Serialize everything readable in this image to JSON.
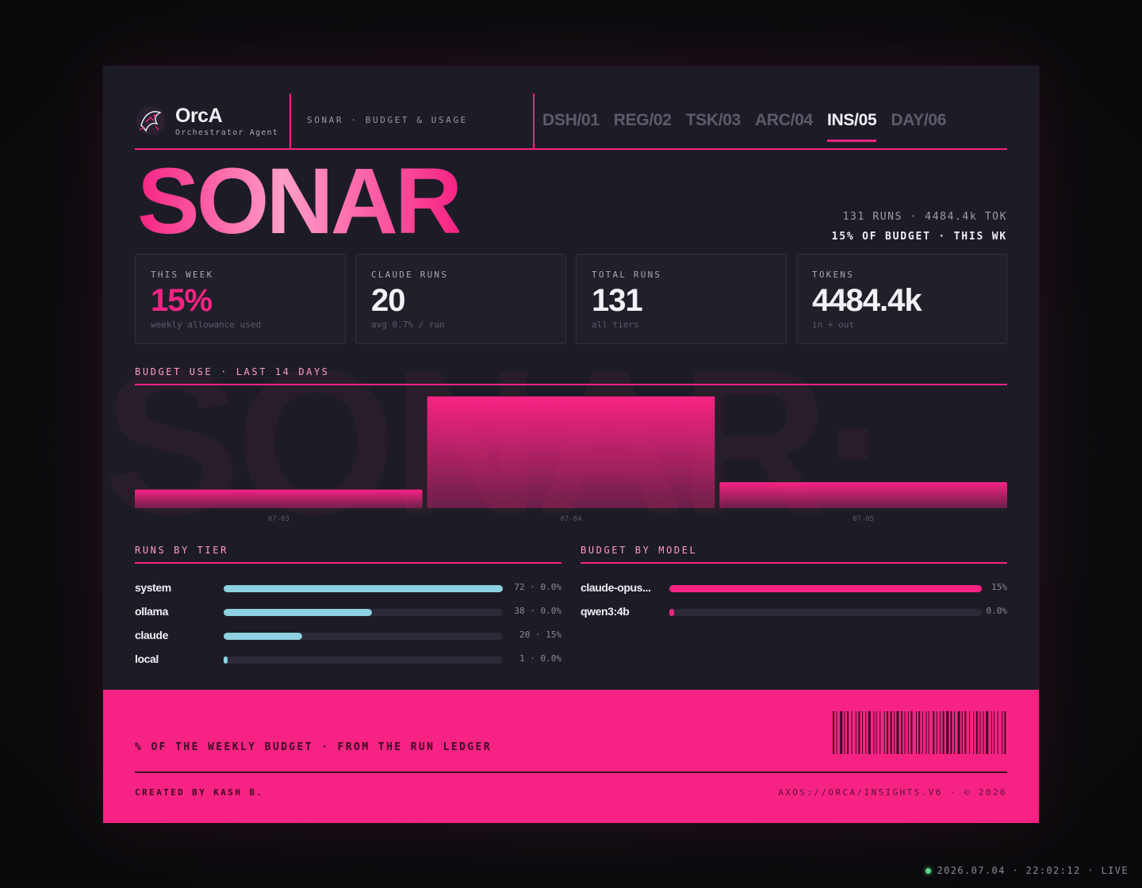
{
  "brand": {
    "name": "OrcA",
    "subtitle": "Orchestrator Agent"
  },
  "breadcrumb": "SONAR · BUDGET & USAGE",
  "nav": {
    "tabs": [
      {
        "label": "DSH/01",
        "active": false
      },
      {
        "label": "REG/02",
        "active": false
      },
      {
        "label": "TSK/03",
        "active": false
      },
      {
        "label": "ARC/04",
        "active": false
      },
      {
        "label": "INS/05",
        "active": true
      },
      {
        "label": "DAY/06",
        "active": false
      }
    ]
  },
  "hero": {
    "title": "SONAR",
    "meta_line1": "131 RUNS · 4484.4k TOK",
    "meta_line2": "15% OF BUDGET · THIS WK",
    "watermark": "SONAR·"
  },
  "stats": [
    {
      "label": "THIS WEEK",
      "value": "15%",
      "note": "weekly allowance used"
    },
    {
      "label": "CLAUDE RUNS",
      "value": "20",
      "note": "avg 0.7% / run"
    },
    {
      "label": "TOTAL RUNS",
      "value": "131",
      "note": "all tiers"
    },
    {
      "label": "TOKENS",
      "value": "4484.4k",
      "note": "in + out"
    }
  ],
  "budget_chart": {
    "title": "BUDGET USE · LAST 14 DAYS"
  },
  "chart_data": {
    "type": "bar",
    "title": "BUDGET USE · LAST 14 DAYS",
    "categories": [
      "07-03",
      "07-04",
      "07-05"
    ],
    "values": [
      2.5,
      15,
      3.5
    ],
    "ylim": [
      0,
      15
    ],
    "grid": false,
    "color": "#f72384"
  },
  "runs_by_tier": {
    "title": "RUNS BY TIER",
    "items": [
      {
        "name": "system",
        "value": "72 · 0.0%",
        "fraction": 1.0
      },
      {
        "name": "ollama",
        "value": "38 · 0.0%",
        "fraction": 0.53
      },
      {
        "name": "claude",
        "value": "20 · 15%",
        "fraction": 0.28
      },
      {
        "name": "local",
        "value": "1 · 0.0%",
        "fraction": 0.01
      }
    ],
    "color": "#8dd1e0"
  },
  "budget_by_model": {
    "title": "BUDGET BY MODEL",
    "items": [
      {
        "name": "claude-opus...",
        "value": "15%",
        "fraction": 1.0
      },
      {
        "name": "qwen3:4b",
        "value": "0.0%",
        "fraction": 0.0
      }
    ],
    "color": "#f72384"
  },
  "footer": {
    "caption": "% OF THE WEEKLY BUDGET · FROM THE RUN LEDGER",
    "credit": "CREATED BY KASH B.",
    "path": "AXOS://ORCA/INSIGHTS.V6 · © 2026"
  },
  "status": {
    "text": "2026.07.04 · 22:02:12 · LIVE"
  },
  "colors": {
    "accent": "#f72384",
    "accent_light": "#ff9ec8",
    "tier": "#8dd1e0",
    "live": "#5fd88a",
    "background": "#1d1c26"
  }
}
